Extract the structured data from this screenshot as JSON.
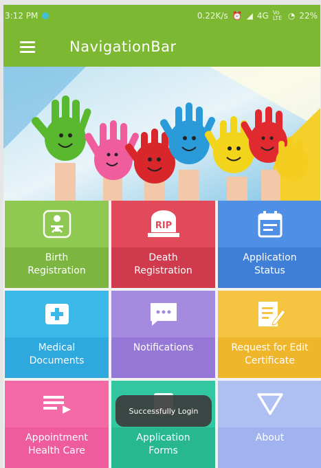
{
  "status_bar": {
    "time": "3:12 PM",
    "network_speed": "0.22K/s",
    "network_type": "4G",
    "volte": "Vo LTE",
    "battery": "22%"
  },
  "app_bar": {
    "title": "NavigationBar",
    "menu_icon": "hamburger-menu-icon",
    "color": "#7cb832"
  },
  "banner": {
    "description_icon": "painted-hands-illustration"
  },
  "tiles": [
    {
      "label": "Birth\nRegistration",
      "icon": "baby-icon",
      "top_color": "#8fc952",
      "bottom_color": "#7cb540"
    },
    {
      "label": "Death\nRegistration",
      "icon": "rip-tombstone-icon",
      "top_color": "#e2495b",
      "bottom_color": "#cf3a4d"
    },
    {
      "label": "Application\nStatus",
      "icon": "calendar-list-icon",
      "top_color": "#4f8fe6",
      "bottom_color": "#3f7fd8"
    },
    {
      "label": "Medical\nDocuments",
      "icon": "medical-cross-icon",
      "top_color": "#3bb7e8",
      "bottom_color": "#2fa9dd"
    },
    {
      "label": "Notifications",
      "icon": "chat-bubble-icon",
      "top_color": "#a58be0",
      "bottom_color": "#9678d6"
    },
    {
      "label": "Request for Edit\nCertificate",
      "icon": "edit-document-icon",
      "top_color": "#f5c440",
      "bottom_color": "#f0b62b"
    },
    {
      "label": "Appointment\nHealth Care",
      "icon": "playlist-icon",
      "top_color": "#f46aa7",
      "bottom_color": "#ee5c9d"
    },
    {
      "label": "Application\nForms",
      "icon": "forms-icon",
      "top_color": "#32c7a0",
      "bottom_color": "#27b890"
    },
    {
      "label": "About",
      "icon": "triangle-down-icon",
      "top_color": "#aebff2",
      "bottom_color": "#a1b3ee"
    }
  ],
  "toast": {
    "text": "Successfully Login"
  }
}
